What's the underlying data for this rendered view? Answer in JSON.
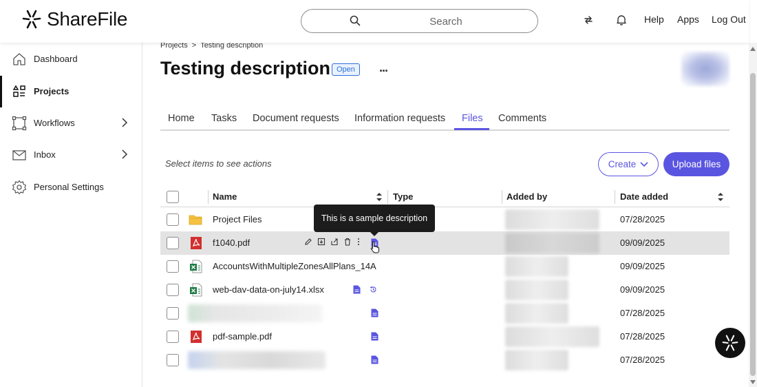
{
  "app": {
    "name": "ShareFile"
  },
  "header": {
    "search_placeholder": "Search",
    "help_label": "Help",
    "apps_label": "Apps",
    "logout_label": "Log Out"
  },
  "sidebar": {
    "items": [
      {
        "label": "Dashboard",
        "icon": "home-icon",
        "active": false,
        "has_submenu": false
      },
      {
        "label": "Projects",
        "icon": "projects-icon",
        "active": true,
        "has_submenu": false
      },
      {
        "label": "Workflows",
        "icon": "workflows-icon",
        "active": false,
        "has_submenu": true
      },
      {
        "label": "Inbox",
        "icon": "mail-icon",
        "active": false,
        "has_submenu": true
      },
      {
        "label": "Personal Settings",
        "icon": "gear-icon",
        "active": false,
        "has_submenu": false
      }
    ]
  },
  "breadcrumb": {
    "parent": "Projects",
    "separator": ">",
    "current": "Testing description"
  },
  "project": {
    "title": "Testing description",
    "status": "Open",
    "more": "..."
  },
  "tabs": [
    {
      "label": "Home",
      "active": false
    },
    {
      "label": "Tasks",
      "active": false
    },
    {
      "label": "Document requests",
      "active": false
    },
    {
      "label": "Information requests",
      "active": false
    },
    {
      "label": "Files",
      "active": true
    },
    {
      "label": "Comments",
      "active": false
    }
  ],
  "toolbar": {
    "hint": "Select items to see actions",
    "create_label": "Create",
    "upload_label": "Upload files"
  },
  "table": {
    "columns": {
      "name": "Name",
      "type": "Type",
      "added_by": "Added by",
      "date_added": "Date added"
    },
    "rows": [
      {
        "name": "Project Files",
        "kind": "folder",
        "date": "07/28/2025",
        "has_description": false,
        "has_history": false
      },
      {
        "name": "f1040.pdf",
        "kind": "pdf",
        "date": "09/09/2025",
        "has_description": true,
        "has_history": false,
        "hover": true
      },
      {
        "name": "AccountsWithMultipleZonesAllPlans_14A...",
        "kind": "excel",
        "date": "09/09/2025",
        "has_description": false,
        "has_history": false
      },
      {
        "name": "web-dav-data-on-july14.xlsx",
        "kind": "excel",
        "date": "09/09/2025",
        "has_description": true,
        "has_history": true
      },
      {
        "name": "",
        "kind": "redacted",
        "date": "07/28/2025",
        "has_description": true,
        "has_history": false
      },
      {
        "name": "pdf-sample.pdf",
        "kind": "pdf",
        "date": "07/28/2025",
        "has_description": true,
        "has_history": false
      },
      {
        "name": "",
        "kind": "redacted",
        "date": "07/28/2025",
        "has_description": true,
        "has_history": false
      }
    ]
  },
  "tooltip": {
    "text": "This is a sample description"
  },
  "colors": {
    "accent": "#5a55e0",
    "pdf_red": "#d32f2f",
    "excel_green": "#1e7b45",
    "folder_yellow": "#f5c242"
  }
}
